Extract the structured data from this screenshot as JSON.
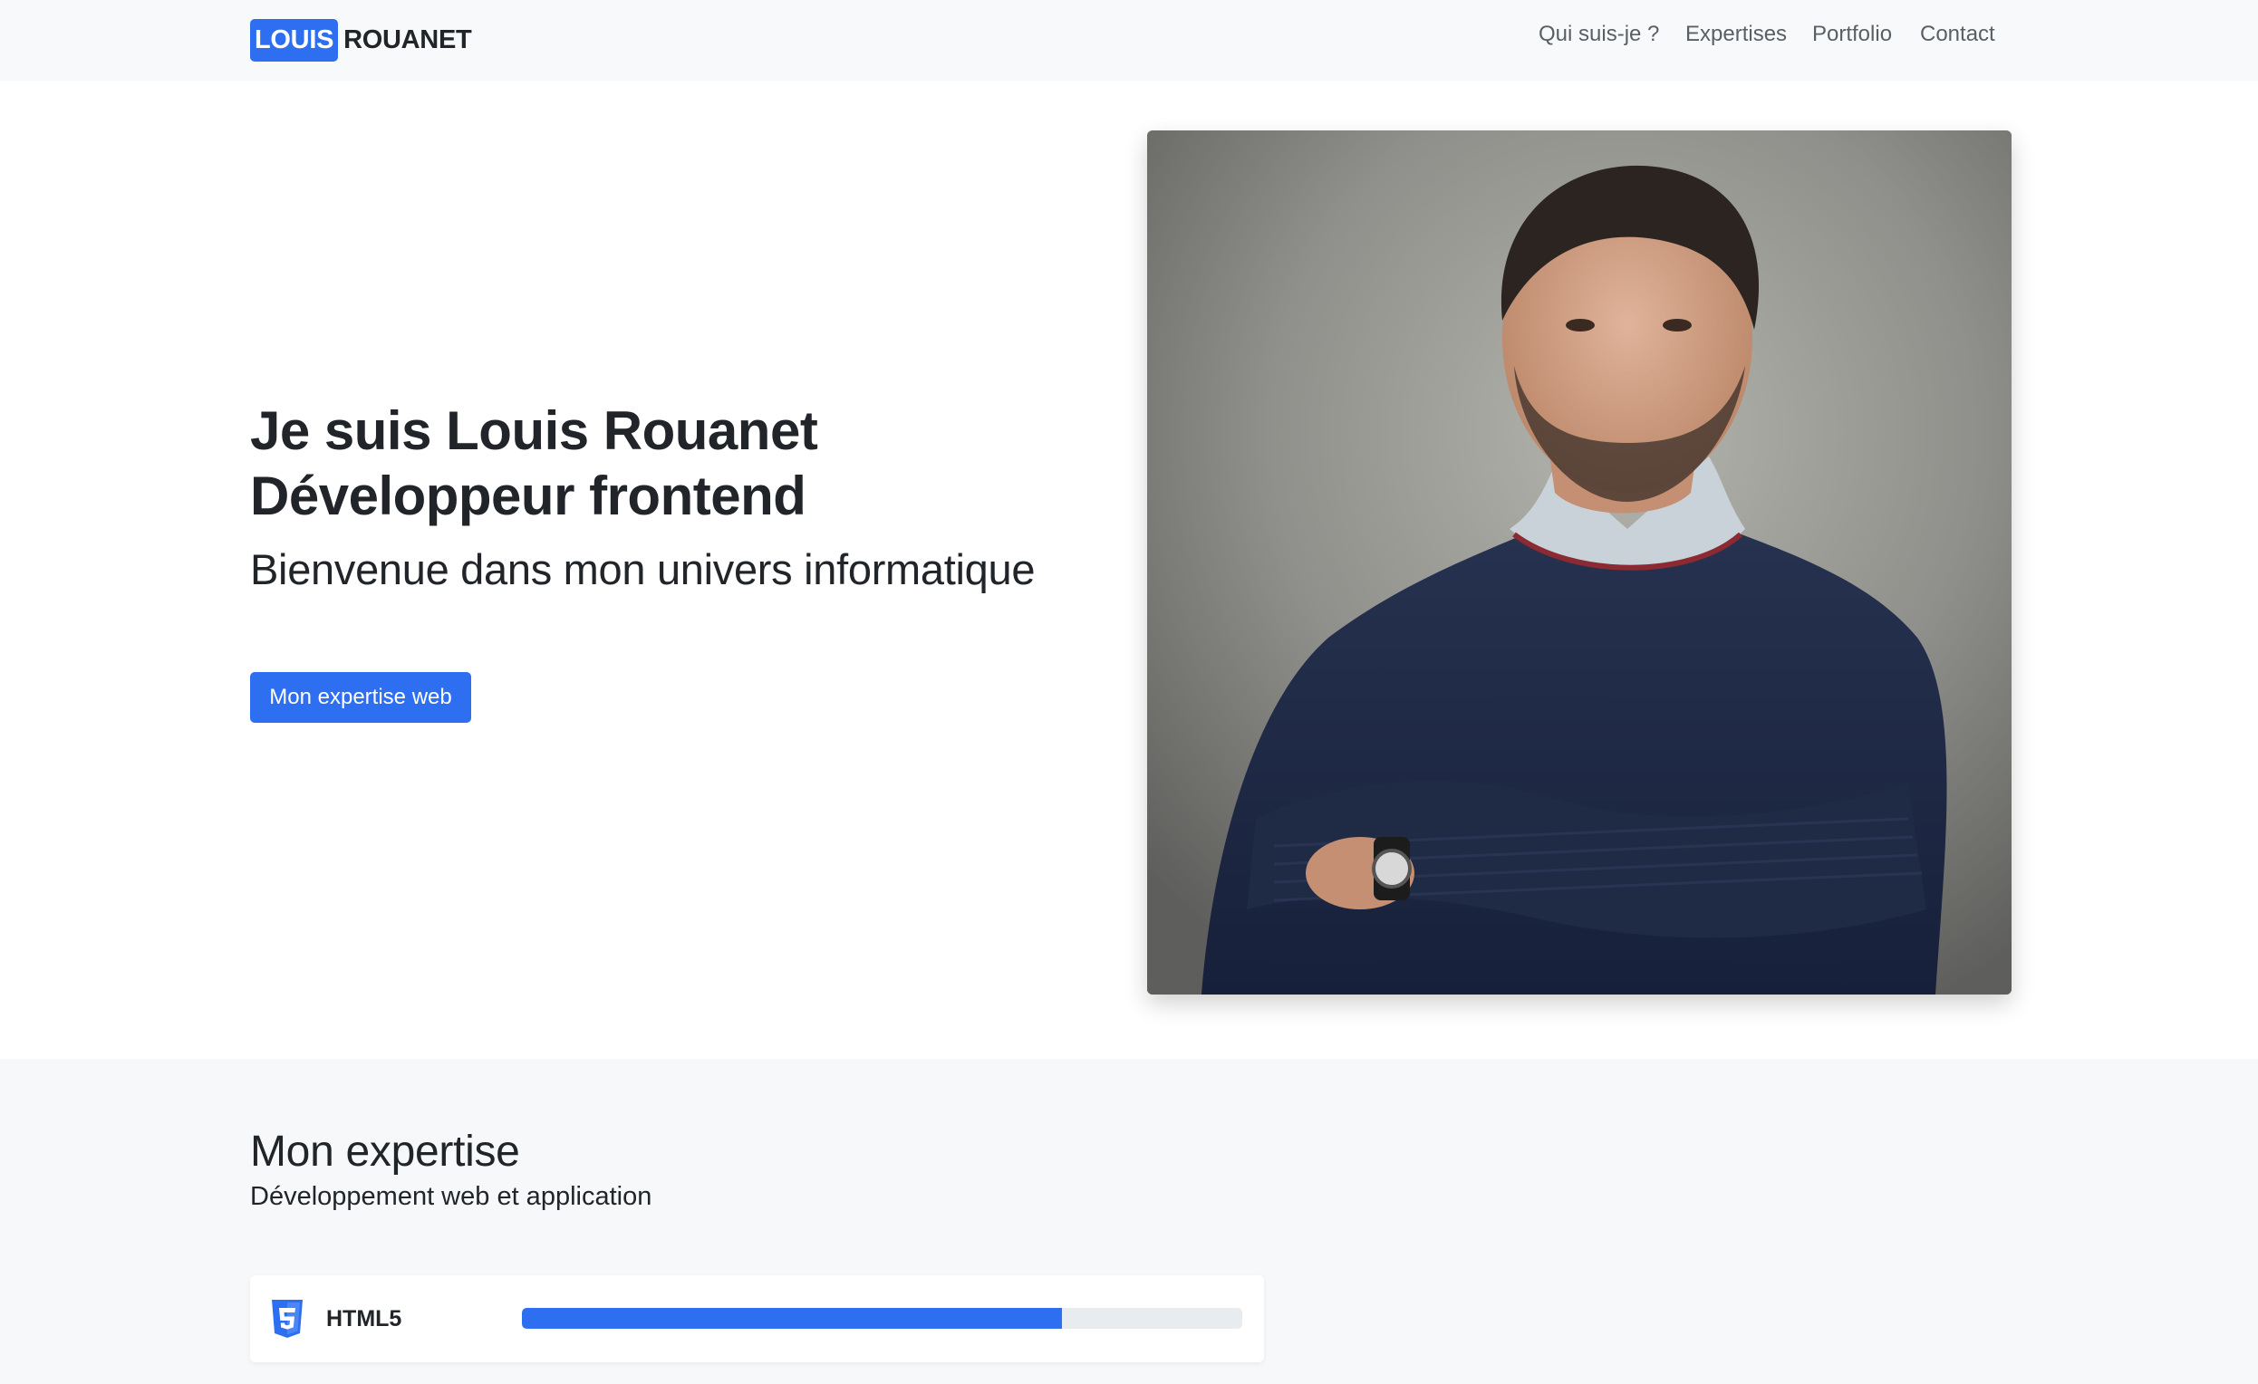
{
  "brand": {
    "first": "LOUIS",
    "last": "ROUANET"
  },
  "nav": {
    "items": [
      {
        "label": "Qui suis-je ?"
      },
      {
        "label": "Expertises"
      },
      {
        "label": "Portfolio"
      },
      {
        "label": "Contact"
      }
    ]
  },
  "hero": {
    "title_line1": "Je suis Louis Rouanet",
    "title_line2": "Développeur frontend",
    "subtitle": "Bienvenue dans mon univers informatique",
    "cta_label": "Mon expertise web"
  },
  "expertise": {
    "title": "Mon expertise",
    "subtitle": "Développement web et application",
    "skills": [
      {
        "name": "HTML5",
        "icon": "html5-icon",
        "level_percent": 75
      }
    ]
  },
  "colors": {
    "accent": "#2d6ff0",
    "navbar_bg": "#f8f9fa",
    "section_bg": "#f7f8fa",
    "text": "#212529",
    "nav_text": "#5a5f66",
    "track": "#e9ecef"
  }
}
